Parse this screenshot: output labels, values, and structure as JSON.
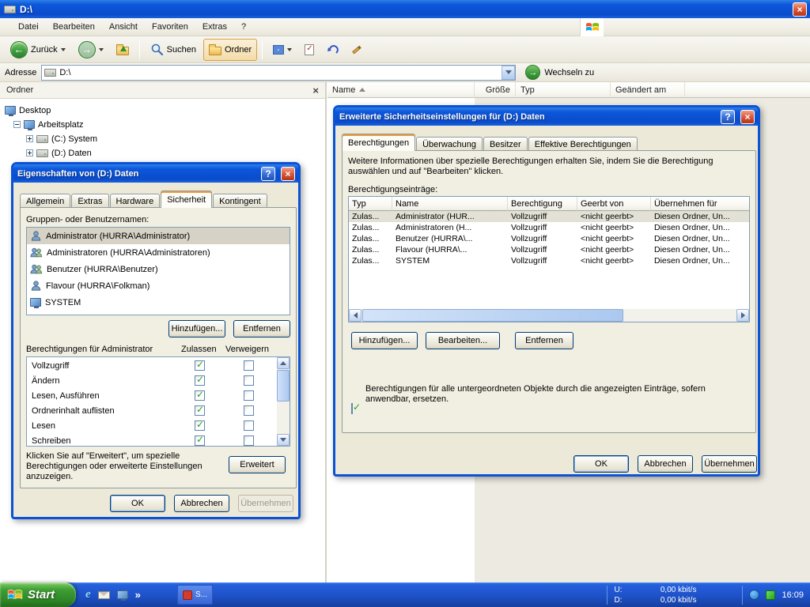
{
  "icons": {
    "close": "×",
    "help": "?",
    "back_arrow": "←",
    "forward_arrow": "→",
    "go_arrow": "→",
    "overflow": "»",
    "ie": "e"
  },
  "window": {
    "title": "D:\\",
    "menu": {
      "items": [
        "Datei",
        "Bearbeiten",
        "Ansicht",
        "Favoriten",
        "Extras",
        "?"
      ]
    },
    "toolbar": {
      "back": "Zurück",
      "search": "Suchen",
      "folders": "Ordner"
    },
    "address": {
      "label": "Adresse",
      "value": "D:\\",
      "go": "Wechseln zu"
    }
  },
  "folders_panel": {
    "title": "Ordner",
    "tree": [
      {
        "label": "Desktop"
      },
      {
        "label": "Arbeitsplatz"
      },
      {
        "label": "(C:) System"
      },
      {
        "label": "(D:) Daten"
      }
    ]
  },
  "file_list": {
    "columns": [
      "Name",
      "Größe",
      "Typ",
      "Geändert am"
    ]
  },
  "properties_dialog": {
    "title": "Eigenschaften von (D:) Daten",
    "tabs": [
      "Allgemein",
      "Extras",
      "Hardware",
      "Sicherheit",
      "Kontingent"
    ],
    "group_label": "Gruppen- oder Benutzernamen:",
    "users": [
      {
        "name": "Administrator (HURRA\\Administrator)"
      },
      {
        "name": "Administratoren (HURRA\\Administratoren)"
      },
      {
        "name": "Benutzer (HURRA\\Benutzer)"
      },
      {
        "name": "Flavour (HURRA\\Folkman)"
      },
      {
        "name": "SYSTEM"
      }
    ],
    "add_button": "Hinzufügen...",
    "remove_button": "Entfernen",
    "permissions_label": "Berechtigungen für Administrator",
    "allow_header": "Zulassen",
    "deny_header": "Verweigern",
    "permissions": [
      "Vollzugriff",
      "Ändern",
      "Lesen, Ausführen",
      "Ordnerinhalt auflisten",
      "Lesen",
      "Schreiben"
    ],
    "allow_states": [
      true,
      true,
      true,
      true,
      true,
      true
    ],
    "deny_states": [
      false,
      false,
      false,
      false,
      false,
      false
    ],
    "hint": "Klicken Sie auf \"Erweitert\", um spezielle Berechtigungen oder erweiterte Einstellungen anzuzeigen.",
    "advanced_button": "Erweitert",
    "ok_button": "OK",
    "cancel_button": "Abbrechen",
    "apply_button": "Übernehmen"
  },
  "advanced_dialog": {
    "title": "Erweiterte Sicherheitseinstellungen für (D:) Daten",
    "tabs": [
      "Berechtigungen",
      "Überwachung",
      "Besitzer",
      "Effektive Berechtigungen"
    ],
    "info": "Weitere Informationen über spezielle Berechtigungen erhalten Sie, indem Sie die Berechtigung auswählen und auf \"Bearbeiten\" klicken.",
    "entries_label": "Berechtigungseinträge:",
    "columns": [
      "Typ",
      "Name",
      "Berechtigung",
      "Geerbt von",
      "Übernehmen für"
    ],
    "rows": [
      [
        "Zulas...",
        "Administrator (HUR...",
        "Vollzugriff",
        "<nicht geerbt>",
        "Diesen Ordner, Un..."
      ],
      [
        "Zulas...",
        "Administratoren (H...",
        "Vollzugriff",
        "<nicht geerbt>",
        "Diesen Ordner, Un..."
      ],
      [
        "Zulas...",
        "Benutzer (HURRA\\...",
        "Vollzugriff",
        "<nicht geerbt>",
        "Diesen Ordner, Un..."
      ],
      [
        "Zulas...",
        "Flavour (HURRA\\...",
        "Vollzugriff",
        "<nicht geerbt>",
        "Diesen Ordner, Un..."
      ],
      [
        "Zulas...",
        "SYSTEM",
        "Vollzugriff",
        "<nicht geerbt>",
        "Diesen Ordner, Un..."
      ]
    ],
    "add_button": "Hinzufügen...",
    "edit_button": "Bearbeiten...",
    "remove_button": "Entfernen",
    "replace_label": "Berechtigungen für alle untergeordneten Objekte durch die angezeigten Einträge, sofern anwendbar, ersetzen.",
    "replace_checked": true,
    "ok_button": "OK",
    "cancel_button": "Abbrechen",
    "apply_button": "Übernehmen"
  },
  "taskbar": {
    "start_label": "Start",
    "app_button": "S...",
    "tray": {
      "upload_label": "U:",
      "upload_value": "0,00 kbit/s",
      "download_label": "D:",
      "download_value": "0,00 kbit/s",
      "time": "16:09"
    }
  }
}
